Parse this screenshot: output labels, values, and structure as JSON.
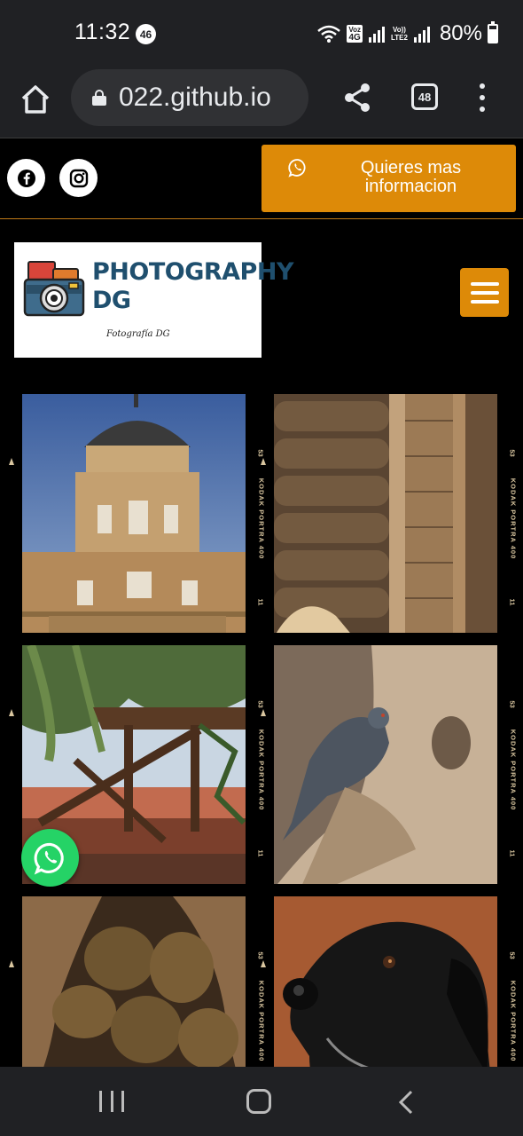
{
  "status_bar": {
    "time": "11:32",
    "notification_count": "46",
    "volte_badge_top": "Voz",
    "volte_badge_bottom": "4G",
    "lte_badge_top": "Vo))",
    "lte_badge_bottom": "LTE2",
    "battery": "80%"
  },
  "browser": {
    "url": "022.github.io",
    "tab_count": "48",
    "icons": [
      "home-icon",
      "lock-icon",
      "share-icon",
      "tabs-icon",
      "more-vert-icon"
    ]
  },
  "topbar": {
    "social": [
      "facebook-icon",
      "instagram-icon"
    ],
    "cta_label": "Quieres mas informacion",
    "accent_color": "#dd8a08"
  },
  "header": {
    "logo_title_line1": "PHOTOGRAPHY",
    "logo_title_line2": "DG",
    "logo_subtitle": "Fotografía DG"
  },
  "gallery": {
    "film_label": "KODAK PORTRA 400",
    "frame_number_top": "53",
    "frame_number_bottom": "11",
    "photos": [
      {
        "subject": "building-tower"
      },
      {
        "subject": "wooden-cabin-door"
      },
      {
        "subject": "pergola-garden"
      },
      {
        "subject": "pigeon-on-tree"
      },
      {
        "subject": "potatoes-in-hands"
      },
      {
        "subject": "black-dog"
      }
    ]
  },
  "floating": {
    "whatsapp": "whatsapp-icon"
  },
  "nav": {
    "icons": [
      "recent-apps-icon",
      "home-nav-icon",
      "back-icon"
    ]
  }
}
